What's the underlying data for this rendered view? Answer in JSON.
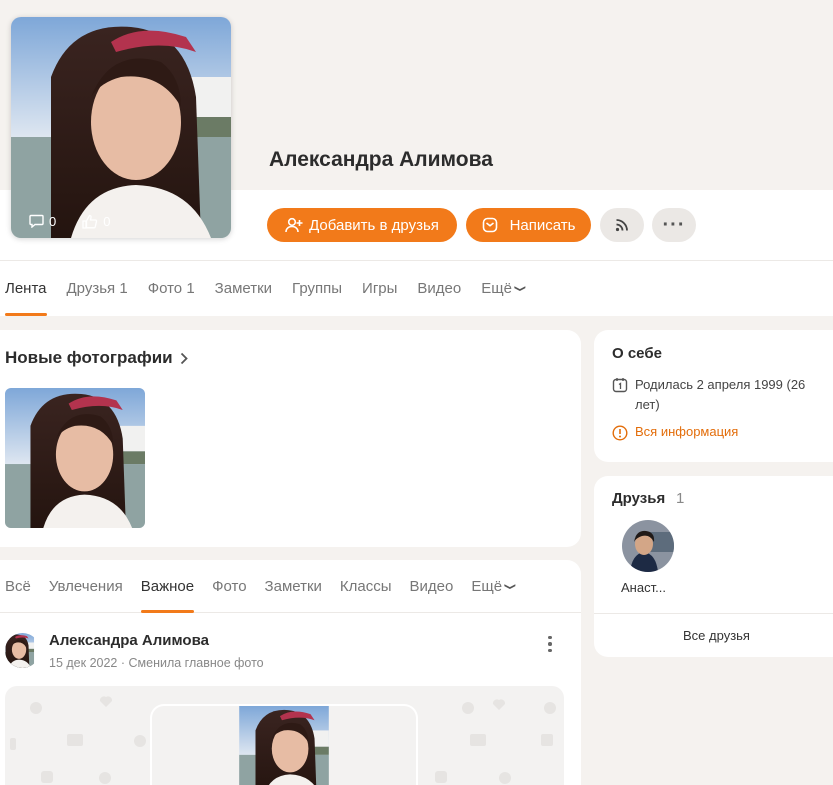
{
  "profile": {
    "name": "Александра Алимова",
    "avatar_comments": "0",
    "avatar_likes": "0"
  },
  "actions": {
    "add_friend": "Добавить в друзья",
    "write": "Написать",
    "more": "···"
  },
  "main_tabs": [
    "Лента",
    "Друзья 1",
    "Фото 1",
    "Заметки",
    "Группы",
    "Игры",
    "Видео",
    "Ещё"
  ],
  "new_photos": {
    "title": "Новые фотографии"
  },
  "feed_tabs": [
    "Всё",
    "Увлечения",
    "Важное",
    "Фото",
    "Заметки",
    "Классы",
    "Видео",
    "Ещё"
  ],
  "post": {
    "author": "Александра Алимова",
    "date": "15 дек 2022",
    "action": "Сменила главное фото"
  },
  "about": {
    "title": "О себе",
    "birth": "Родилась 2 апреля 1999 (26 лет)",
    "all_info": "Вся информация"
  },
  "friends": {
    "title": "Друзья",
    "count": "1",
    "items": [
      {
        "name": "Анаст..."
      }
    ],
    "all_label": "Все друзья"
  },
  "colors": {
    "accent": "#f27a1a",
    "link": "#e36d0a",
    "background": "#f5f2ef"
  }
}
